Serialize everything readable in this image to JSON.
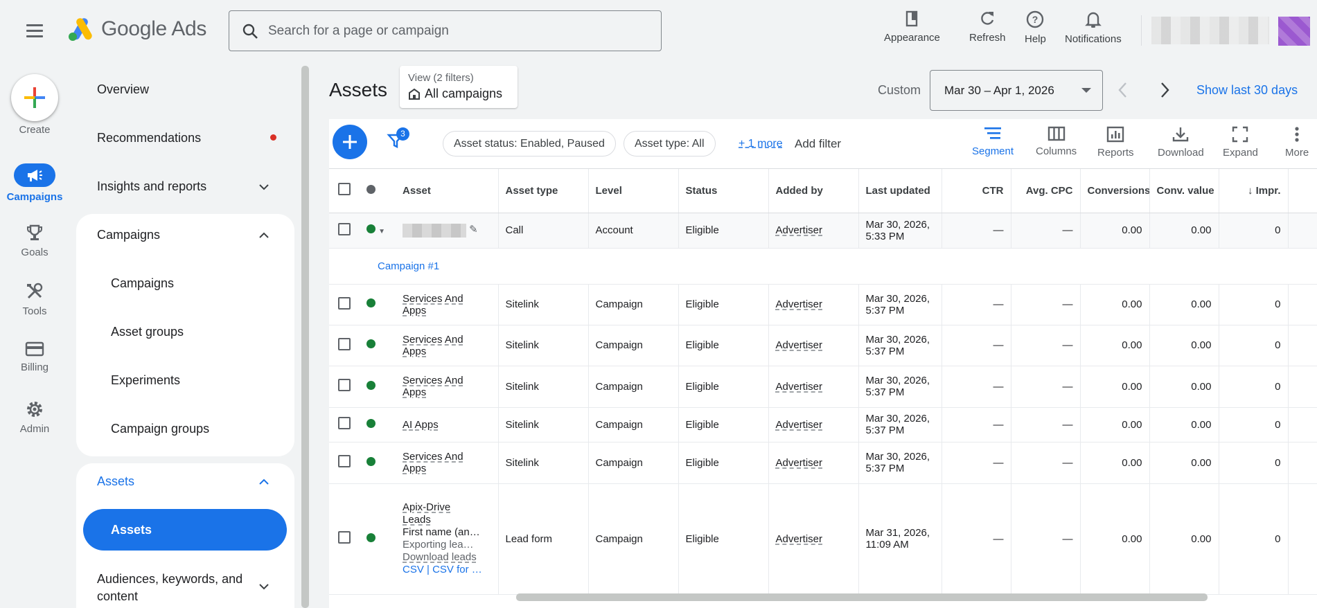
{
  "header": {
    "app_name": "Google Ads",
    "search_placeholder": "Search for a page or campaign",
    "actions": [
      {
        "label": "Appearance",
        "icon": "appearance-icon"
      },
      {
        "label": "Refresh",
        "icon": "refresh-icon"
      },
      {
        "label": "Help",
        "icon": "help-icon"
      },
      {
        "label": "Notifications",
        "icon": "bell-icon"
      }
    ]
  },
  "rail": {
    "create": "Create",
    "items": [
      {
        "label": "Campaigns",
        "icon": "megaphone-icon",
        "active": true
      },
      {
        "label": "Goals",
        "icon": "trophy-icon"
      },
      {
        "label": "Tools",
        "icon": "tools-icon"
      },
      {
        "label": "Billing",
        "icon": "credit-card-icon"
      },
      {
        "label": "Admin",
        "icon": "gear-icon"
      }
    ]
  },
  "nav": {
    "overview": "Overview",
    "recommendations": "Recommendations",
    "insights": "Insights and reports",
    "campaigns_section": "Campaigns",
    "campaigns_sub": [
      "Campaigns",
      "Asset groups",
      "Experiments",
      "Campaign groups"
    ],
    "assets_section": "Assets",
    "assets_active": "Assets",
    "audiences": "Audiences, keywords, and content"
  },
  "page": {
    "title": "Assets",
    "view_label": "View (2 filters)",
    "view_value": "All campaigns",
    "date_mode": "Custom",
    "date_range": "Mar 30 – Apr 1, 2026",
    "show_last": "Show last 30 days"
  },
  "toolbar": {
    "filter_count": "3",
    "chips": [
      "Asset status: Enabled, Paused",
      "Asset type: All"
    ],
    "more": "+ 1 more",
    "add_filter": "Add filter",
    "tools": [
      "Segment",
      "Columns",
      "Reports",
      "Download",
      "Expand",
      "More"
    ]
  },
  "table": {
    "columns": [
      "Asset",
      "Asset type",
      "Level",
      "Status",
      "Added by",
      "Last updated",
      "CTR",
      "Avg. CPC",
      "Conversions",
      "Conv. value",
      "Impr."
    ],
    "account_row": {
      "type": "Call",
      "level": "Account",
      "status": "Eligible",
      "added_by": "Advertiser",
      "updated_1": "Mar 30, 2026,",
      "updated_2": "5:33 PM",
      "ctr": "—",
      "cpc": "—",
      "conv": "0.00",
      "conv_value": "0.00",
      "impr": "0"
    },
    "group_label": "Campaign #1",
    "rows": [
      {
        "asset_1": "Services And",
        "asset_2": "Apps",
        "type": "Sitelink",
        "level": "Campaign",
        "status": "Eligible",
        "added_by": "Advertiser",
        "updated_1": "Mar 30, 2026,",
        "updated_2": "5:37 PM",
        "ctr": "—",
        "cpc": "—",
        "conv": "0.00",
        "conv_value": "0.00",
        "impr": "0"
      },
      {
        "asset_1": "Services And",
        "asset_2": "Apps",
        "type": "Sitelink",
        "level": "Campaign",
        "status": "Eligible",
        "added_by": "Advertiser",
        "updated_1": "Mar 30, 2026,",
        "updated_2": "5:37 PM",
        "ctr": "—",
        "cpc": "—",
        "conv": "0.00",
        "conv_value": "0.00",
        "impr": "0"
      },
      {
        "asset_1": "Services And",
        "asset_2": "Apps",
        "type": "Sitelink",
        "level": "Campaign",
        "status": "Eligible",
        "added_by": "Advertiser",
        "updated_1": "Mar 30, 2026,",
        "updated_2": "5:37 PM",
        "ctr": "—",
        "cpc": "—",
        "conv": "0.00",
        "conv_value": "0.00",
        "impr": "0"
      },
      {
        "asset_1": "AI Apps",
        "asset_2": "",
        "type": "Sitelink",
        "level": "Campaign",
        "status": "Eligible",
        "added_by": "Advertiser",
        "updated_1": "Mar 30, 2026,",
        "updated_2": "5:37 PM",
        "ctr": "—",
        "cpc": "—",
        "conv": "0.00",
        "conv_value": "0.00",
        "impr": "0"
      },
      {
        "asset_1": "Services And",
        "asset_2": "Apps",
        "type": "Sitelink",
        "level": "Campaign",
        "status": "Eligible",
        "added_by": "Advertiser",
        "updated_1": "Mar 30, 2026,",
        "updated_2": "5:37 PM",
        "ctr": "—",
        "cpc": "—",
        "conv": "0.00",
        "conv_value": "0.00",
        "impr": "0"
      }
    ],
    "lead_row": {
      "title_1": "Apix-Drive",
      "title_2": "Leads",
      "line_1": "First name (an…",
      "line_2": "Exporting lea…",
      "download": "Download leads",
      "csv": "CSV | CSV for …",
      "type": "Lead form",
      "level": "Campaign",
      "status": "Eligible",
      "added_by": "Advertiser",
      "updated_1": "Mar 31, 2026,",
      "updated_2": "11:09 AM",
      "ctr": "—",
      "cpc": "—",
      "conv": "0.00",
      "conv_value": "0.00",
      "impr": "0"
    }
  },
  "colors": {
    "brand_blue": "#1a73e8",
    "status_green": "#188038",
    "alert_red": "#d93025"
  }
}
